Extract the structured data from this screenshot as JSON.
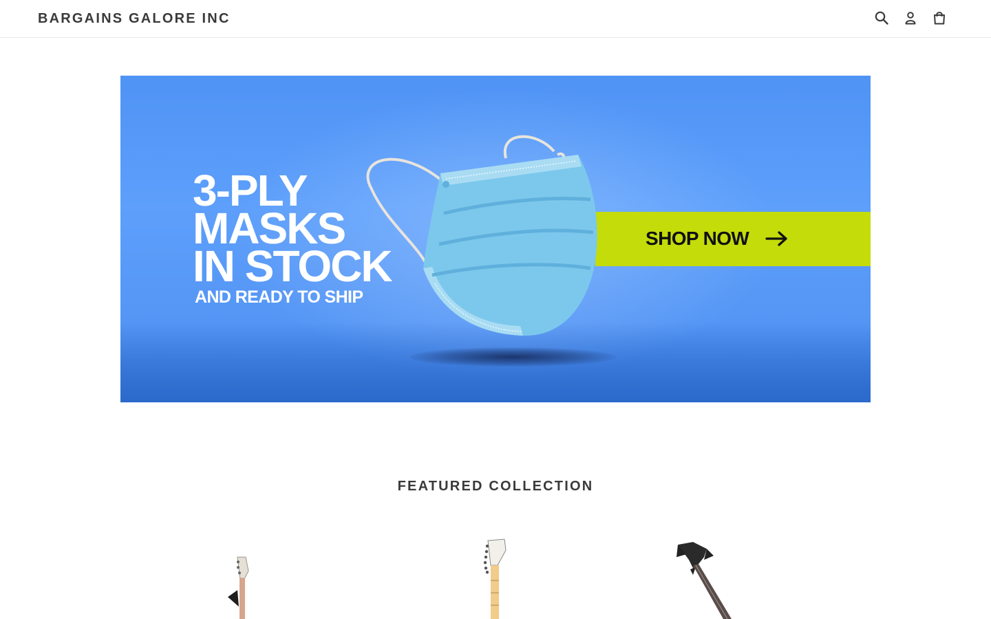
{
  "header": {
    "logo": "BARGAINS GALORE INC",
    "icons": [
      "search-icon",
      "account-icon",
      "cart-icon"
    ]
  },
  "hero": {
    "headline_lines": [
      "3-PLY",
      "MASKS",
      "IN STOCK"
    ],
    "subline": "AND READY TO SHIP",
    "cta_label": "SHOP NOW",
    "colors": {
      "background": "#5a9cf8",
      "cta_background": "#c3dc0a",
      "mask": "#7cc8ec"
    }
  },
  "featured": {
    "title": "FEATURED COLLECTION",
    "products": [
      {
        "image": "guitar-image-light-wood"
      },
      {
        "image": "guitar-image-maple"
      },
      {
        "image": "bass-guitar-image-black"
      }
    ]
  }
}
